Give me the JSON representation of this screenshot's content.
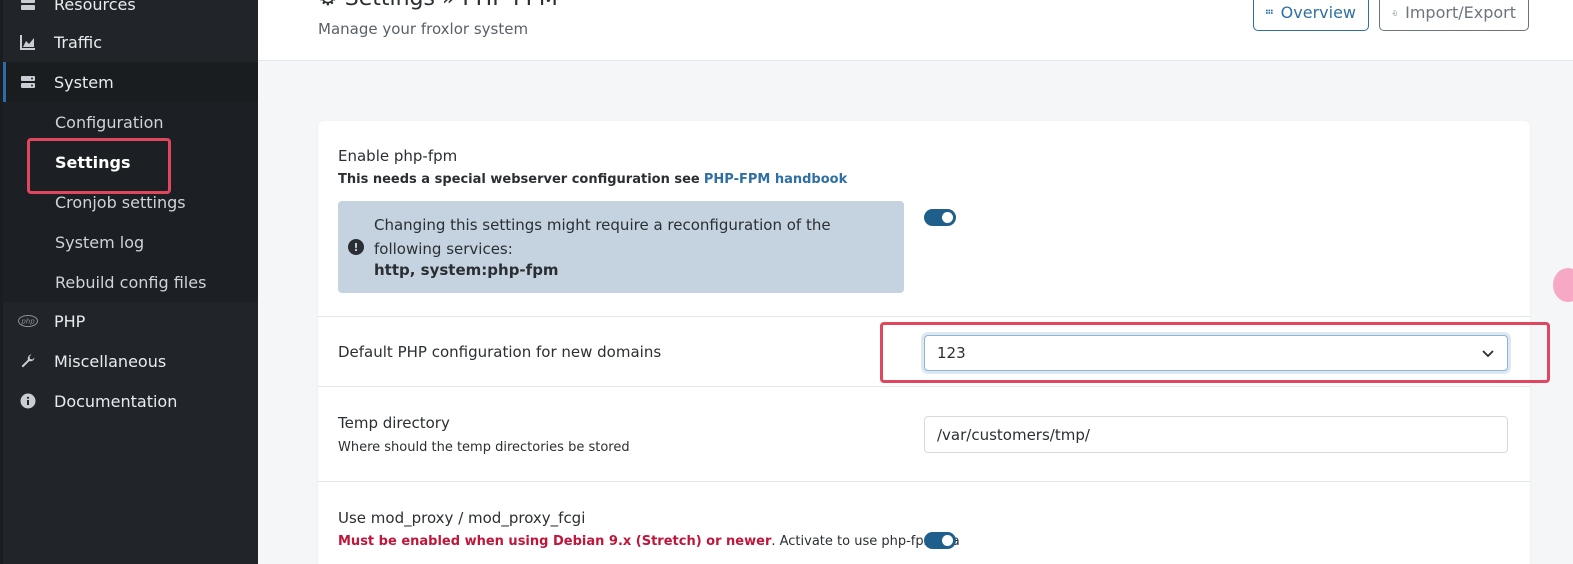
{
  "sidebar": {
    "items": [
      {
        "label": "Resources",
        "icon": "server-icon"
      },
      {
        "label": "Traffic",
        "icon": "chart-area-icon"
      },
      {
        "label": "System",
        "icon": "server-stack-icon"
      },
      {
        "label": "PHP",
        "icon": "php-icon"
      },
      {
        "label": "Miscellaneous",
        "icon": "wrench-icon"
      },
      {
        "label": "Documentation",
        "icon": "info-circle-icon"
      }
    ],
    "system_sub": [
      {
        "label": "Configuration"
      },
      {
        "label": "Settings"
      },
      {
        "label": "Cronjob settings"
      },
      {
        "label": "System log"
      },
      {
        "label": "Rebuild config files"
      }
    ]
  },
  "header": {
    "title": "Settings » PHP-FPM",
    "subtitle": "Manage your froxlor system",
    "overview_label": "Overview",
    "import_export_label": "Import/Export"
  },
  "settings": {
    "enable_fpm": {
      "label": "Enable php-fpm",
      "note": "This needs a special webserver configuration see",
      "link": "PHP-FPM handbook",
      "alert_text": "Changing this settings might require a reconfiguration of the following services:",
      "alert_services": "http, system:php-fpm",
      "enabled": true
    },
    "default_config": {
      "label": "Default PHP configuration for new domains",
      "value": "123"
    },
    "temp_dir": {
      "label": "Temp directory",
      "desc": "Where should the temp directories be stored",
      "value": "/var/customers/tmp/"
    },
    "mod_proxy": {
      "label": "Use mod_proxy / mod_proxy_fcgi",
      "warn": "Must be enabled when using Debian 9.x (Stretch) or newer",
      "desc": ". Activate to use php-fpm via",
      "enabled": true
    }
  },
  "colors": {
    "sidebar_bg": "#212529",
    "accent": "#2f6fa3",
    "highlight": "#e0475e",
    "alert_bg": "#c4d3df"
  }
}
